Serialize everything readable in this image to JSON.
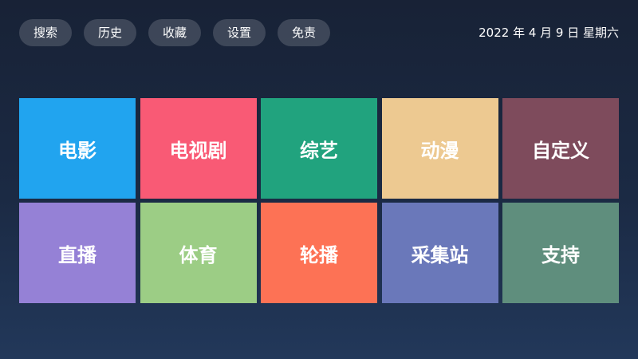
{
  "nav": {
    "items": [
      {
        "id": "search",
        "label": "搜索"
      },
      {
        "id": "history",
        "label": "历史"
      },
      {
        "id": "favorites",
        "label": "收藏"
      },
      {
        "id": "settings",
        "label": "设置"
      },
      {
        "id": "disclaimer",
        "label": "免责"
      }
    ]
  },
  "clock": {
    "text": "2022 年 4 月 9 日 星期六"
  },
  "tiles": [
    {
      "id": "movie",
      "label": "电影",
      "color": "#21a4ef"
    },
    {
      "id": "tv-series",
      "label": "电视剧",
      "color": "#f95a75"
    },
    {
      "id": "variety",
      "label": "综艺",
      "color": "#21a37e"
    },
    {
      "id": "anime",
      "label": "动漫",
      "color": "#edc991"
    },
    {
      "id": "custom",
      "label": "自定义",
      "color": "#7e4b5c"
    },
    {
      "id": "live",
      "label": "直播",
      "color": "#9581d6"
    },
    {
      "id": "sports",
      "label": "体育",
      "color": "#9ccd85"
    },
    {
      "id": "carousel",
      "label": "轮播",
      "color": "#fd7255"
    },
    {
      "id": "collection-site",
      "label": "采集站",
      "color": "#6a78ba"
    },
    {
      "id": "support",
      "label": "支持",
      "color": "#5f8e7d"
    }
  ]
}
